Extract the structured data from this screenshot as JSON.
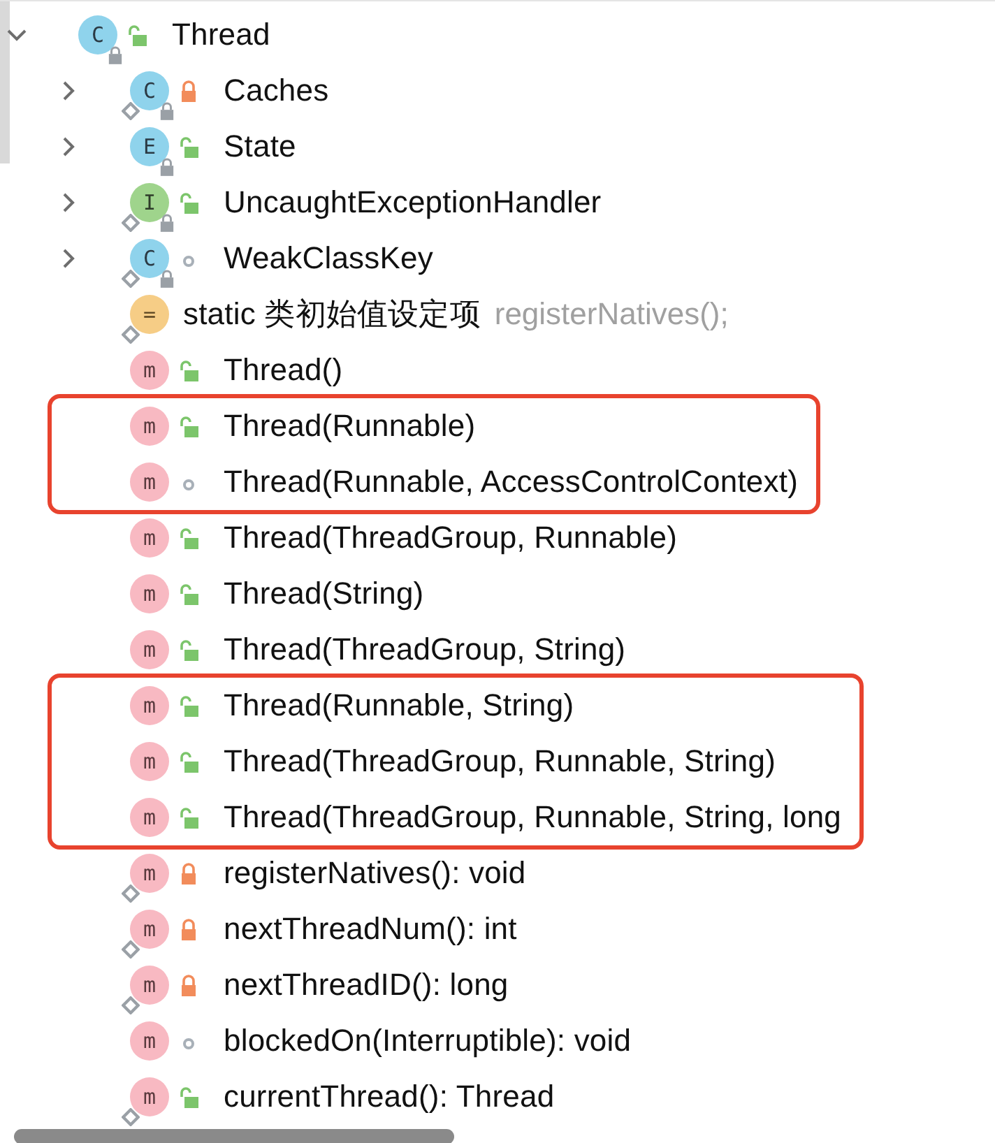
{
  "tree": {
    "label": "Thread",
    "kind": "class",
    "icon_letter": "C",
    "access": {
      "kind": "public"
    },
    "static": false,
    "final": true,
    "expanded": true,
    "children": [
      {
        "label": "Caches",
        "kind": "class",
        "icon_letter": "C",
        "access": {
          "kind": "private"
        },
        "static": true,
        "final": true,
        "expanded": false,
        "highlighted": false
      },
      {
        "label": "State",
        "kind": "enum",
        "icon_letter": "E",
        "access": {
          "kind": "public"
        },
        "static": false,
        "final": true,
        "expanded": false,
        "highlighted": false
      },
      {
        "label": "UncaughtExceptionHandler",
        "kind": "interface",
        "icon_letter": "I",
        "access": {
          "kind": "public"
        },
        "static": true,
        "final": true,
        "expanded": false,
        "highlighted": false
      },
      {
        "label": "WeakClassKey",
        "kind": "class",
        "icon_letter": "C",
        "access": {
          "kind": "package"
        },
        "static": true,
        "final": true,
        "expanded": false,
        "highlighted": false
      },
      {
        "label": "static 类初始值设定项",
        "hint": "registerNatives();",
        "kind": "initializer",
        "icon_letter": "=",
        "static": true,
        "final": false,
        "highlighted": false
      },
      {
        "label": "Thread()",
        "kind": "method",
        "icon_letter": "m",
        "access": {
          "kind": "public"
        },
        "static": false,
        "final": false,
        "highlighted": false
      },
      {
        "label": "Thread(Runnable)",
        "kind": "method",
        "icon_letter": "m",
        "access": {
          "kind": "public"
        },
        "static": false,
        "final": false,
        "highlighted": true
      },
      {
        "label": "Thread(Runnable, AccessControlContext)",
        "kind": "method",
        "icon_letter": "m",
        "access": {
          "kind": "package"
        },
        "static": false,
        "final": false,
        "highlighted": true
      },
      {
        "label": "Thread(ThreadGroup, Runnable)",
        "kind": "method",
        "icon_letter": "m",
        "access": {
          "kind": "public"
        },
        "static": false,
        "final": false,
        "highlighted": false
      },
      {
        "label": "Thread(String)",
        "kind": "method",
        "icon_letter": "m",
        "access": {
          "kind": "public"
        },
        "static": false,
        "final": false,
        "highlighted": false
      },
      {
        "label": "Thread(ThreadGroup, String)",
        "kind": "method",
        "icon_letter": "m",
        "access": {
          "kind": "public"
        },
        "static": false,
        "final": false,
        "highlighted": false
      },
      {
        "label": "Thread(Runnable, String)",
        "kind": "method",
        "icon_letter": "m",
        "access": {
          "kind": "public"
        },
        "static": false,
        "final": false,
        "highlighted": true
      },
      {
        "label": "Thread(ThreadGroup, Runnable, String)",
        "kind": "method",
        "icon_letter": "m",
        "access": {
          "kind": "public"
        },
        "static": false,
        "final": false,
        "highlighted": true
      },
      {
        "label": "Thread(ThreadGroup, Runnable, String, long",
        "kind": "method",
        "icon_letter": "m",
        "access": {
          "kind": "public"
        },
        "static": false,
        "final": false,
        "highlighted": true
      },
      {
        "label": "registerNatives(): void",
        "kind": "method",
        "icon_letter": "m",
        "access": {
          "kind": "private"
        },
        "static": true,
        "final": false,
        "highlighted": false
      },
      {
        "label": "nextThreadNum(): int",
        "kind": "method",
        "icon_letter": "m",
        "access": {
          "kind": "private"
        },
        "static": true,
        "final": false,
        "highlighted": false
      },
      {
        "label": "nextThreadID(): long",
        "kind": "method",
        "icon_letter": "m",
        "access": {
          "kind": "private"
        },
        "static": true,
        "final": false,
        "highlighted": false
      },
      {
        "label": "blockedOn(Interruptible): void",
        "kind": "method",
        "icon_letter": "m",
        "access": {
          "kind": "package"
        },
        "static": false,
        "final": false,
        "highlighted": false
      },
      {
        "label": "currentThread(): Thread",
        "kind": "method",
        "icon_letter": "m",
        "access": {
          "kind": "public"
        },
        "static": true,
        "final": false,
        "highlighted": false
      }
    ]
  }
}
